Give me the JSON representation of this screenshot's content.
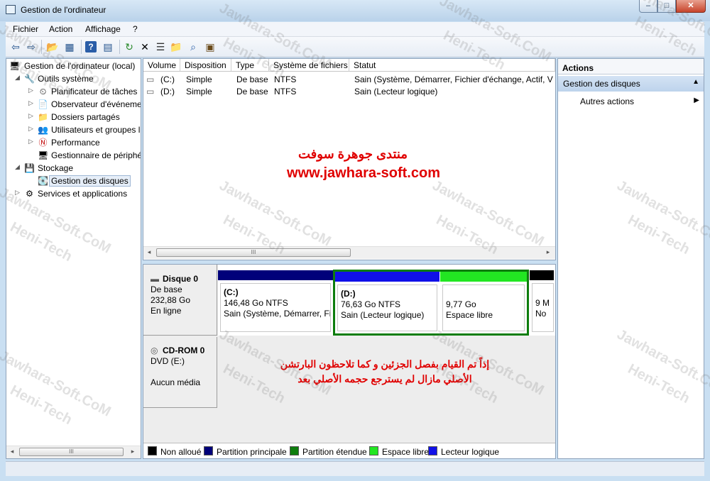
{
  "window": {
    "title": "Gestion de l'ordinateur",
    "controls": {
      "minimize": "–",
      "maximize": "□",
      "close": "✕"
    }
  },
  "menu": [
    "Fichier",
    "Action",
    "Affichage",
    "?"
  ],
  "toolbar": [
    "back-icon",
    "forward-icon",
    "up-folder-icon",
    "show-hide-tree-icon",
    "help-icon",
    "console-tree-icon",
    "refresh-icon",
    "delete-icon",
    "properties-icon",
    "open-folder-icon",
    "search-icon",
    "export-icon"
  ],
  "tree": {
    "root": "Gestion de l'ordinateur (local)",
    "items": [
      {
        "label": "Outils système",
        "icon": "tools-icon",
        "glyph": "🔧"
      },
      {
        "label": "Planificateur de tâches",
        "icon": "clock-icon",
        "glyph": "⏲"
      },
      {
        "label": "Observateur d'événeme",
        "icon": "event-viewer-icon",
        "glyph": "📄"
      },
      {
        "label": "Dossiers partagés",
        "icon": "shared-folder-icon",
        "glyph": "📁"
      },
      {
        "label": "Utilisateurs et groupes l",
        "icon": "users-icon",
        "glyph": "👥"
      },
      {
        "label": "Performance",
        "icon": "performance-icon",
        "glyph": "Ⓝ"
      },
      {
        "label": "Gestionnaire de périphé",
        "icon": "device-manager-icon",
        "glyph": "🖥"
      },
      {
        "label": "Stockage",
        "icon": "storage-icon",
        "glyph": "💾"
      },
      {
        "label": "Gestion des disques",
        "icon": "disk-management-icon",
        "glyph": "💽"
      },
      {
        "label": "Services et applications",
        "icon": "services-icon",
        "glyph": "⚙"
      }
    ]
  },
  "volumes": {
    "headers": [
      "Volume",
      "Disposition",
      "Type",
      "Système de fichiers",
      "Statut"
    ],
    "rows": [
      [
        "(C:)",
        "Simple",
        "De base",
        "NTFS",
        "Sain (Système, Démarrer, Fichier d'échange, Actif, Vid"
      ],
      [
        "(D:)",
        "Simple",
        "De base",
        "NTFS",
        "Sain (Lecteur logique)"
      ]
    ]
  },
  "disks": {
    "disk0": {
      "name": "Disque 0",
      "type": "De base",
      "size": "232,88 Go",
      "state": "En ligne",
      "partitions": [
        {
          "name": "(C:)",
          "size": "146,48 Go NTFS",
          "status": "Sain (Système, Démarrer, Fic",
          "color": "#00007a"
        },
        {
          "name": "(D:)",
          "size": "76,63 Go NTFS",
          "status": "Sain (Lecteur logique)",
          "color": "#1010e8"
        },
        {
          "name": "",
          "size": "9,77 Go",
          "status": "Espace libre",
          "color": "#22e622"
        },
        {
          "name": "",
          "size": "9 M",
          "status": "No",
          "color": "#000000"
        }
      ]
    },
    "cdrom0": {
      "name": "CD-ROM 0",
      "type": "DVD (E:)",
      "media": "Aucun média"
    }
  },
  "legend": [
    {
      "label": "Non alloué",
      "color": "#000000"
    },
    {
      "label": "Partition principale",
      "color": "#00007a"
    },
    {
      "label": "Partition étendue",
      "color": "#0d7d0d"
    },
    {
      "label": "Espace libre",
      "color": "#22e622"
    },
    {
      "label": "Lecteur logique",
      "color": "#1010e8"
    }
  ],
  "actions": {
    "title": "Actions",
    "section": "Gestion des disques",
    "more": "Autres actions"
  },
  "overlay": {
    "forum_name": "منتدى جوهرة سوفت",
    "url": "www.jawhara-soft.com",
    "note_line1": "إذاً تم القيام بفصل الجزئين و كما تلاحظون البارتشن",
    "note_line2": "الأصلي مازال لم يسترجع حجمه الأصلي بعد",
    "watermark1": "Jawhara-Soft.CoM",
    "watermark2": "Heni-Tech"
  },
  "scroll_glyph": "III",
  "accent_colors": {
    "selection": "#e6eef8",
    "titlebar": "#c9dff2",
    "overlay_text": "#e00000"
  }
}
